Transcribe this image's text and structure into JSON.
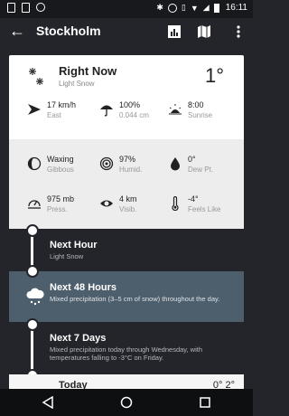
{
  "status": {
    "time": "16:11"
  },
  "toolbar": {
    "title": "Stockholm"
  },
  "now": {
    "title": "Right Now",
    "condition": "Light Snow",
    "temperature": "1°"
  },
  "metrics": [
    {
      "value": "17 km/h",
      "label": "East",
      "icon": "wind-icon"
    },
    {
      "value": "100%",
      "label": "0.044 cm",
      "icon": "umbrella-icon"
    },
    {
      "value": "8:00",
      "label": "Sunrise",
      "icon": "sunrise-icon"
    },
    {
      "value": "Waxing",
      "label": "Gibbous",
      "icon": "moon-icon"
    },
    {
      "value": "97%",
      "label": "Humid.",
      "icon": "humidity-icon"
    },
    {
      "value": "0°",
      "label": "Dew Pt.",
      "icon": "dew-drop-icon"
    },
    {
      "value": "975 mb",
      "label": "Press.",
      "icon": "pressure-icon"
    },
    {
      "value": "4 km",
      "label": "Visib.",
      "icon": "eye-icon"
    },
    {
      "value": "-4°",
      "label": "Feels Like",
      "icon": "thermometer-icon"
    }
  ],
  "timeline": [
    {
      "title": "Next Hour",
      "summary": "Light Snow"
    },
    {
      "title": "Next 48 Hours",
      "summary": "Mixed precipitation (3–5 cm of snow) throughout the day."
    },
    {
      "title": "Next 7 Days",
      "summary": "Mixed precipitation today through Wednesday, with temperatures falling to -3°C on Friday."
    }
  ],
  "today": {
    "title": "Today",
    "temps": "0° 2°"
  }
}
